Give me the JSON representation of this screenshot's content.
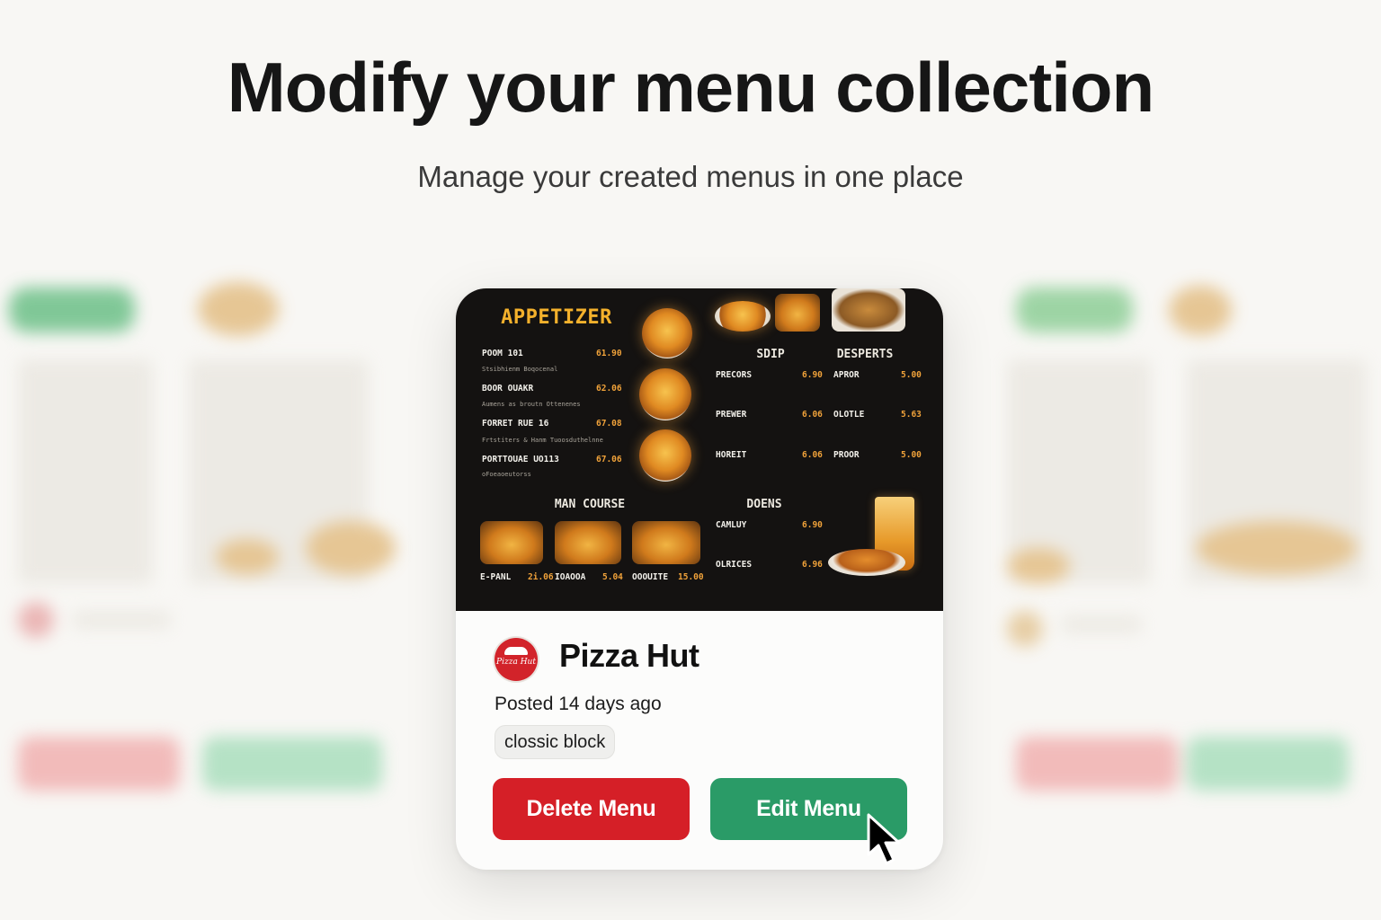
{
  "header": {
    "title": "Modify your menu collection",
    "subtitle": "Manage your created menus in one place"
  },
  "card": {
    "menu_preview": {
      "sections": {
        "appetizer": "APPETIZER",
        "soup": "SDIP",
        "desserts": "DESPERTS",
        "main_course": "MAN COURSE",
        "drinks": "DOENS"
      },
      "appetizer_items": [
        {
          "name": "POOM 101",
          "price": "61.90",
          "desc": "Stsibhienm Boqocenal"
        },
        {
          "name": "BOOR OUAKR",
          "price": "62.06",
          "desc": "Aumens as broutn Ottenenes"
        },
        {
          "name": "FORRET RUE 16",
          "price": "67.08",
          "desc": "Frtstiters & Hanm Tuoosduthelnne"
        },
        {
          "name": "PORTTOUAE UO113",
          "price": "67.06",
          "desc": "oFoeaoeutorss"
        }
      ],
      "soup_items": [
        {
          "name": "PRECORS",
          "price": "6.90"
        },
        {
          "name": "PREWER",
          "price": "6.06"
        },
        {
          "name": "HOREIT",
          "price": "6.06"
        }
      ],
      "dessert_items": [
        {
          "name": "APROR",
          "price": "5.00"
        },
        {
          "name": "OLOTLE",
          "price": "5.63"
        },
        {
          "name": "PROOR",
          "price": "5.00"
        }
      ],
      "drink_items": [
        {
          "name": "CAMLUY",
          "price": "6.90"
        },
        {
          "name": "OLRICES",
          "price": "6.96"
        }
      ],
      "main_items": [
        {
          "name": "E-PANL",
          "price": "2i.06"
        },
        {
          "name": "IOAOOA",
          "price": "5.04"
        },
        {
          "name": "OOOUITE",
          "price": "15.00"
        }
      ]
    },
    "brand_name": "Pizza Hut",
    "brand_logo_text": "Pizza Hut",
    "posted": "Posted 14 days ago",
    "tag": "clossic block",
    "delete_label": "Delete Menu",
    "edit_label": "Edit Menu",
    "colors": {
      "delete": "#d51f27",
      "edit": "#2a9b67",
      "brand": "#d2232a"
    }
  },
  "cursor_icon": "mouse-pointer-icon"
}
